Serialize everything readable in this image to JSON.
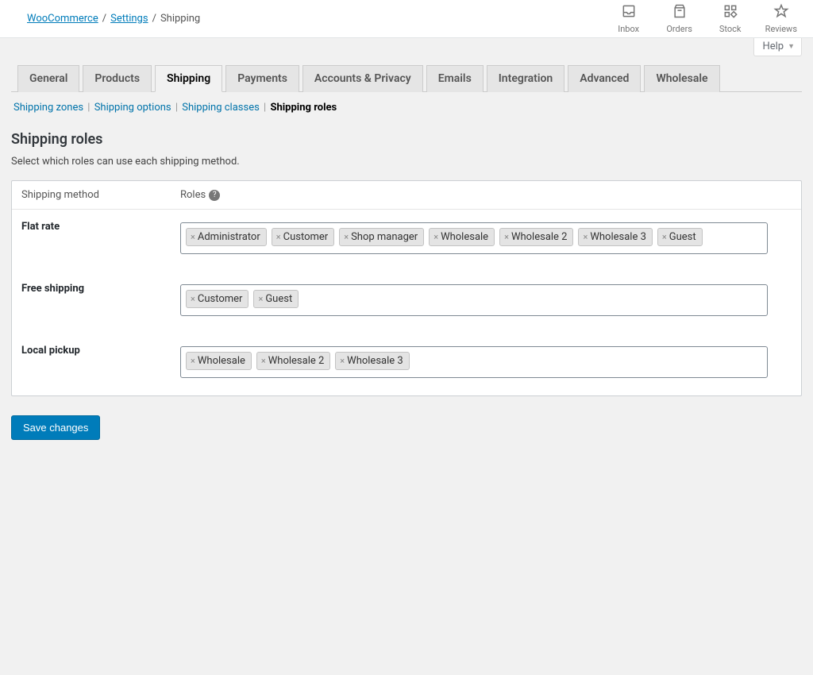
{
  "breadcrumbs": {
    "root": "WooCommerce",
    "mid": "Settings",
    "current": "Shipping"
  },
  "toolbox": {
    "inbox": "Inbox",
    "orders": "Orders",
    "stock": "Stock",
    "reviews": "Reviews"
  },
  "help_tab": "Help",
  "tabs": [
    "General",
    "Products",
    "Shipping",
    "Payments",
    "Accounts & Privacy",
    "Emails",
    "Integration",
    "Advanced",
    "Wholesale"
  ],
  "active_tab_index": 2,
  "subnav": {
    "items": [
      "Shipping zones",
      "Shipping options",
      "Shipping classes",
      "Shipping roles"
    ],
    "current_index": 3
  },
  "page_title": "Shipping roles",
  "page_desc": "Select which roles can use each shipping method.",
  "table": {
    "col_method": "Shipping method",
    "col_roles": "Roles",
    "rows": [
      {
        "method": "Flat rate",
        "roles": [
          "Administrator",
          "Customer",
          "Shop manager",
          "Wholesale",
          "Wholesale 2",
          "Wholesale 3",
          "Guest"
        ]
      },
      {
        "method": "Free shipping",
        "roles": [
          "Customer",
          "Guest"
        ]
      },
      {
        "method": "Local pickup",
        "roles": [
          "Wholesale",
          "Wholesale 2",
          "Wholesale 3"
        ]
      }
    ]
  },
  "save_label": "Save changes"
}
